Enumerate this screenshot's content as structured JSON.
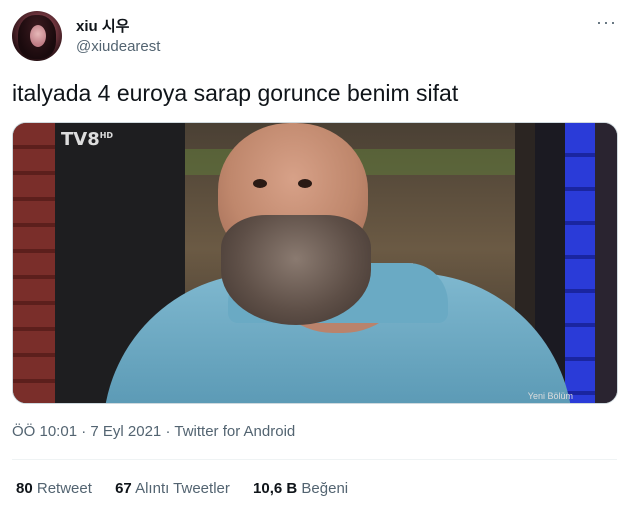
{
  "user": {
    "name": "xiu 시우",
    "handle": "@xiudearest"
  },
  "menu": {
    "more_label": "···"
  },
  "tweet": {
    "text": "italyada 4 euroya sarap gorunce benim sifat"
  },
  "media": {
    "channel_logo": "TV8",
    "channel_suffix": "HD",
    "caption": "Yeni Bölüm"
  },
  "meta": {
    "time": "ÖÖ 10:01",
    "separator": "·",
    "date": "7 Eyl 2021",
    "source": "Twitter for Android"
  },
  "stats": {
    "retweets_count": "80",
    "retweets_label": "Retweet",
    "quotes_count": "67",
    "quotes_label": "Alıntı Tweetler",
    "likes_count": "10,6 B",
    "likes_label": "Beğeni"
  },
  "colors": {
    "text_primary": "#0f1419",
    "text_secondary": "#536471",
    "divider": "#eff3f4"
  }
}
